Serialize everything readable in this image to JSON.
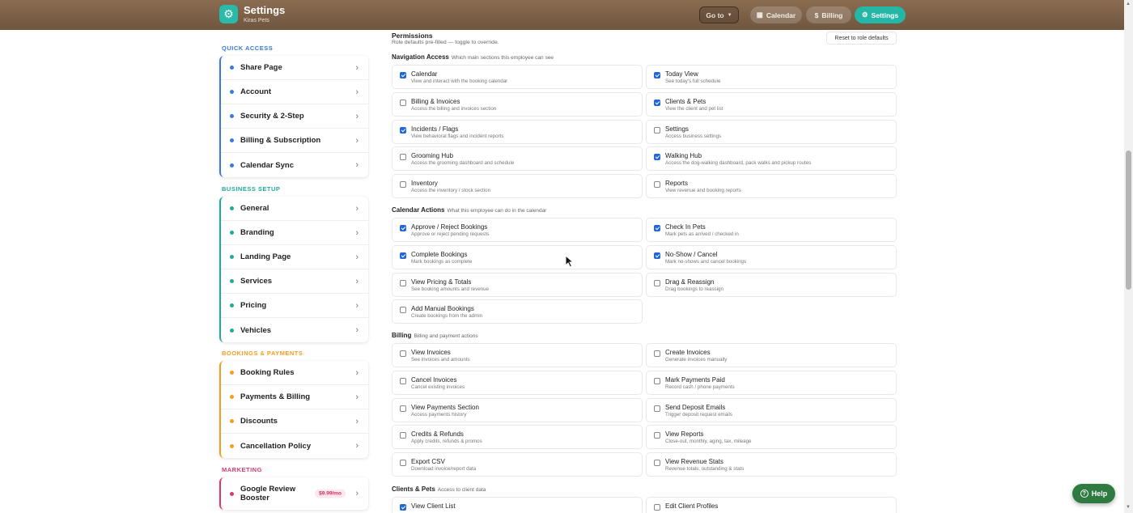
{
  "header": {
    "title": "Settings",
    "subtitle": "Kiras Pets",
    "goto_label": "Go to",
    "calendar_label": "Calendar",
    "billing_label": "Billing",
    "settings_label": "Settings"
  },
  "colors": {
    "accent": "#25b7a6",
    "quick": "#3b7bd4",
    "business": "#22a99a",
    "bookings": "#f0a020",
    "marketing": "#d63a6e"
  },
  "sidebar": {
    "quick_title": "QUICK ACCESS",
    "quick": [
      "Share Page",
      "Account",
      "Security & 2-Step",
      "Billing & Subscription",
      "Calendar Sync"
    ],
    "business_title": "BUSINESS SETUP",
    "business": [
      "General",
      "Branding",
      "Landing Page",
      "Services",
      "Pricing",
      "Vehicles"
    ],
    "bookings_title": "BOOKINGS & PAYMENTS",
    "bookings": [
      "Booking Rules",
      "Payments & Billing",
      "Discounts",
      "Cancellation Policy"
    ],
    "marketing_title": "MARKETING",
    "marketing_item": "Google Review Booster",
    "marketing_badge": "$9.99/mo"
  },
  "permissions": {
    "title": "Permissions",
    "subtitle": "Role defaults pre-filled — toggle to override.",
    "reset_label": "Reset to role defaults",
    "nav": {
      "title": "Navigation Access",
      "sub": "Which main sections this employee can see",
      "items": [
        {
          "label": "Calendar",
          "desc": "View and interact with the booking calendar",
          "checked": true
        },
        {
          "label": "Today View",
          "desc": "See today's full schedule",
          "checked": true
        },
        {
          "label": "Billing & Invoices",
          "desc": "Access the billing and invoices section",
          "checked": false
        },
        {
          "label": "Clients & Pets",
          "desc": "View the client and pet list",
          "checked": true
        },
        {
          "label": "Incidents / Flags",
          "desc": "View behavioral flags and incident reports",
          "checked": true
        },
        {
          "label": "Settings",
          "desc": "Access business settings",
          "checked": false
        },
        {
          "label": "Grooming Hub",
          "desc": "Access the grooming dashboard and schedule",
          "checked": false
        },
        {
          "label": "Walking Hub",
          "desc": "Access the dog-walking dashboard, pack walks and pickup routes",
          "checked": true
        },
        {
          "label": "Inventory",
          "desc": "Access the inventory / stock section",
          "checked": false
        },
        {
          "label": "Reports",
          "desc": "View revenue and booking reports",
          "checked": false
        }
      ]
    },
    "cal": {
      "title": "Calendar Actions",
      "sub": "What this employee can do in the calendar",
      "items": [
        {
          "label": "Approve / Reject Bookings",
          "desc": "Approve or reject pending requests",
          "checked": true
        },
        {
          "label": "Check In Pets",
          "desc": "Mark pets as arrived / checked in",
          "checked": true
        },
        {
          "label": "Complete Bookings",
          "desc": "Mark bookings as complete",
          "checked": true
        },
        {
          "label": "No-Show / Cancel",
          "desc": "Mark no-shows and cancel bookings",
          "checked": true
        },
        {
          "label": "View Pricing & Totals",
          "desc": "See booking amounts and revenue",
          "checked": false
        },
        {
          "label": "Drag & Reassign",
          "desc": "Drag bookings to reassign",
          "checked": false
        },
        {
          "label": "Add Manual Bookings",
          "desc": "Create bookings from the admin",
          "checked": false
        }
      ]
    },
    "billing": {
      "title": "Billing",
      "sub": "Billing and payment actions",
      "items": [
        {
          "label": "View Invoices",
          "desc": "See invoices and amounts",
          "checked": false
        },
        {
          "label": "Create Invoices",
          "desc": "Generate invoices manually",
          "checked": false
        },
        {
          "label": "Cancel Invoices",
          "desc": "Cancel existing invoices",
          "checked": false
        },
        {
          "label": "Mark Payments Paid",
          "desc": "Record cash / phone payments",
          "checked": false
        },
        {
          "label": "View Payments Section",
          "desc": "Access payments history",
          "checked": false
        },
        {
          "label": "Send Deposit Emails",
          "desc": "Trigger deposit request emails",
          "checked": false
        },
        {
          "label": "Credits & Refunds",
          "desc": "Apply credits, refunds & promos",
          "checked": false
        },
        {
          "label": "View Reports",
          "desc": "Close-out, monthly, aging, tax, mileage",
          "checked": false
        },
        {
          "label": "Export CSV",
          "desc": "Download invoice/report data",
          "checked": false
        },
        {
          "label": "View Revenue Stats",
          "desc": "Revenue totals, outstanding & stats",
          "checked": false
        }
      ]
    },
    "clients": {
      "title": "Clients & Pets",
      "sub": "Access to client data",
      "items": [
        {
          "label": "View Client List",
          "desc": "",
          "checked": true
        },
        {
          "label": "Edit Client Profiles",
          "desc": "",
          "checked": false
        }
      ]
    }
  },
  "help_label": "Help"
}
